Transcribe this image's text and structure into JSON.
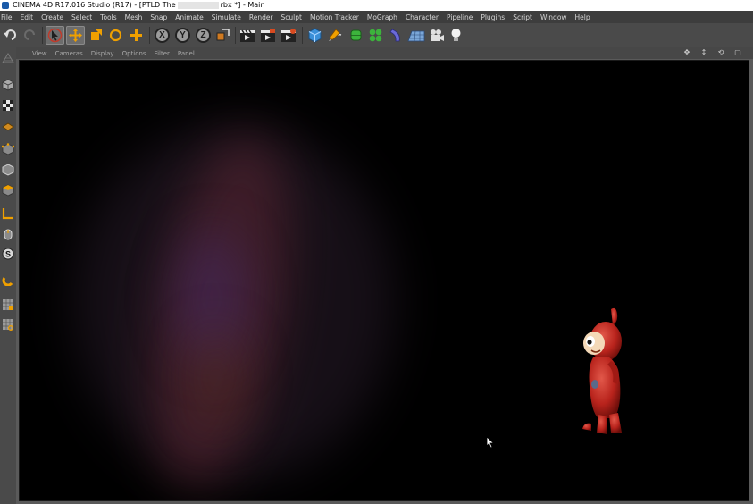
{
  "window": {
    "title_prefix": "CINEMA 4D R17.016 Studio (R17) - [PTLD The",
    "title_suffix": "rbx *] - Main"
  },
  "menu": [
    "File",
    "Edit",
    "Create",
    "Select",
    "Tools",
    "Mesh",
    "Snap",
    "Animate",
    "Simulate",
    "Render",
    "Sculpt",
    "Motion Tracker",
    "MoGraph",
    "Character",
    "Pipeline",
    "Plugins",
    "Script",
    "Window",
    "Help"
  ],
  "toolbar": {
    "axis_x": "X",
    "axis_y": "Y",
    "axis_z": "Z"
  },
  "viewport_menu": [
    "View",
    "Cameras",
    "Display",
    "Options",
    "Filter",
    "Panel"
  ],
  "left_tools": {
    "smooth_label": "S"
  },
  "colors": {
    "accent_orange": "#f0a000",
    "character_red": "#b8231c"
  }
}
